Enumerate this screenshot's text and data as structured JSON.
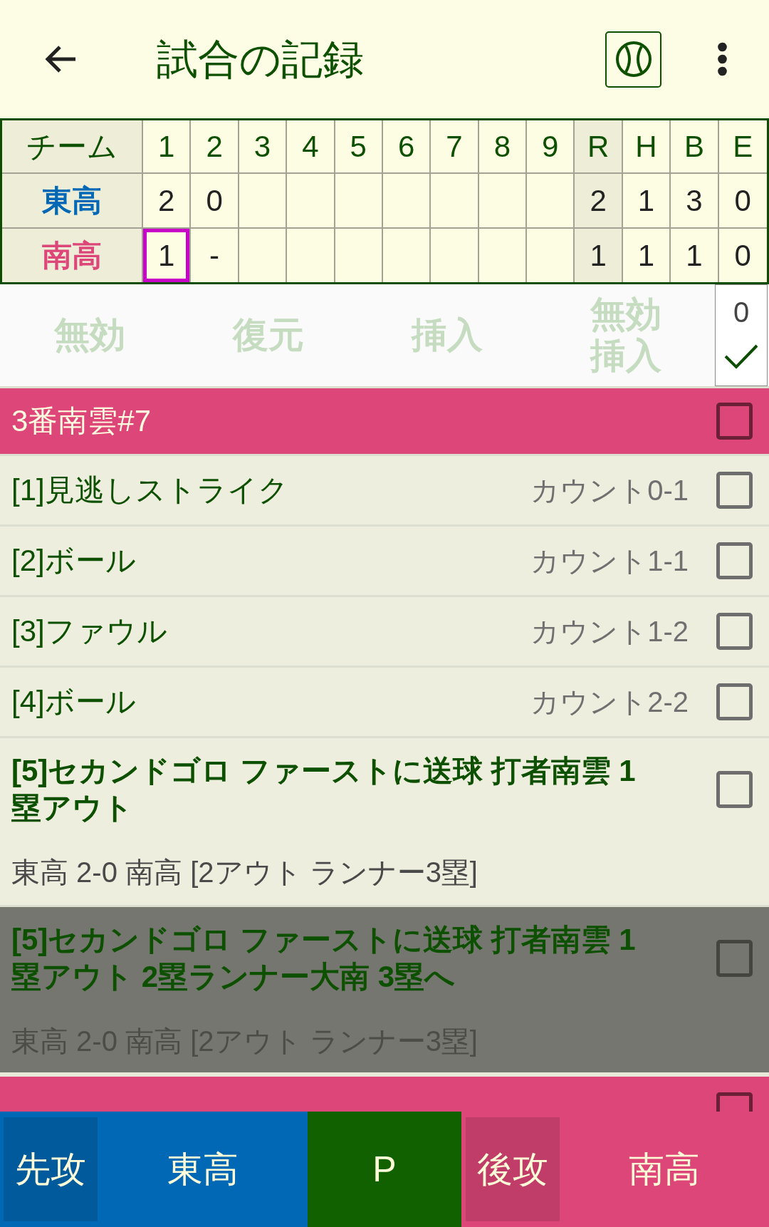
{
  "app_bar": {
    "title": "試合の記録"
  },
  "scoreboard": {
    "team_heading": "チーム",
    "innings": [
      "1",
      "2",
      "3",
      "4",
      "5",
      "6",
      "7",
      "8",
      "9"
    ],
    "totals": [
      "R",
      "H",
      "B",
      "E"
    ],
    "rows": [
      {
        "team": "東高",
        "color": "#0068b4",
        "innings": [
          {
            "value": "2",
            "selected": false
          },
          {
            "value": "0",
            "selected": false
          }
        ],
        "totals": [
          "2",
          "1",
          "3",
          "0"
        ]
      },
      {
        "team": "南高",
        "color": "#dd4679",
        "innings": [
          {
            "value": "1",
            "selected": true
          },
          {
            "value": "-",
            "selected": false
          }
        ],
        "totals": [
          "1",
          "1",
          "1",
          "0"
        ]
      }
    ]
  },
  "actions": [
    {
      "label": "無効",
      "disabled": true
    },
    {
      "label": "復元",
      "disabled": true
    },
    {
      "label": "挿入",
      "disabled": true
    },
    {
      "label": "無効挿入",
      "disabled": true
    }
  ],
  "counter": {
    "count": "0"
  },
  "plays": [
    {
      "kind": "batter",
      "label": "3番南雲#7",
      "checked": false
    },
    {
      "kind": "pitch",
      "label": "[1]見逃しストライク",
      "count": "カウント0-1",
      "checked": false
    },
    {
      "kind": "pitch",
      "label": "[2]ボール",
      "count": "カウント1-1",
      "checked": false
    },
    {
      "kind": "pitch",
      "label": "[3]ファウル",
      "count": "カウント1-2",
      "checked": false
    },
    {
      "kind": "pitch",
      "label": "[4]ボール",
      "count": "カウント2-2",
      "checked": false
    },
    {
      "kind": "result",
      "label": "[5]セカンドゴロ ファーストに送球 打者南雲 1塁アウト",
      "score": "東高 2-0 南高 [2アウト ランナー3塁]",
      "checked": false,
      "disabled": false
    },
    {
      "kind": "result",
      "label": "[5]セカンドゴロ ファーストに送球 打者南雲 1塁アウト 2塁ランナー大南 3塁へ",
      "score": "東高 2-0 南高 [2アウト ランナー3塁]",
      "checked": false,
      "disabled": true
    },
    {
      "kind": "batter",
      "checked": false
    }
  ],
  "bottom_bar": {
    "top_team": {
      "side": "先攻",
      "name": "東高",
      "color": "#0068b4"
    },
    "pitcher": "P",
    "bottom_team": {
      "side": "後攻",
      "name": "南高",
      "color": "#dd4679"
    }
  }
}
